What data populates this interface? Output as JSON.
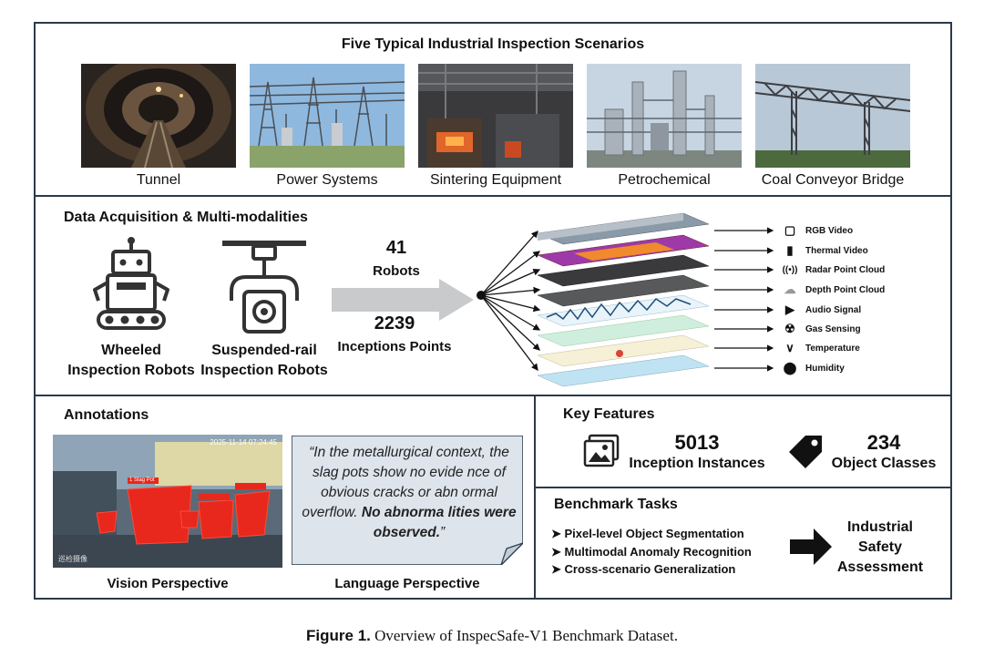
{
  "scenarios": {
    "title": "Five Typical Industrial Inspection Scenarios",
    "items": [
      "Tunnel",
      "Power Systems",
      "Sintering Equipment",
      "Petrochemical",
      "Coal Conveyor Bridge"
    ]
  },
  "acquisition": {
    "title": "Data Acquisition & Multi-modalities",
    "wheeled_label_1": "Wheeled",
    "wheeled_label_2": "Inspection Robots",
    "rail_label_1": "Suspended-rail",
    "rail_label_2": "Inspection Robots",
    "robots_count": "41",
    "robots_label": "Robots",
    "points_count": "2239",
    "points_label": "Inceptions Points",
    "modalities": [
      {
        "icon": "video-camera-icon",
        "label": "RGB Video"
      },
      {
        "icon": "camera-icon",
        "label": "Thermal Video"
      },
      {
        "icon": "radar-icon",
        "label": "Radar Point Cloud"
      },
      {
        "icon": "cloud-icon",
        "label": "Depth Point Cloud"
      },
      {
        "icon": "speaker-icon",
        "label": "Audio Signal"
      },
      {
        "icon": "radiation-icon",
        "label": "Gas Sensing"
      },
      {
        "icon": "thermometer-icon",
        "label": "Temperature"
      },
      {
        "icon": "droplet-icon",
        "label": "Humidity"
      }
    ]
  },
  "annotations": {
    "title": "Annotations",
    "vision_label": "Vision Perspective",
    "language_label": "Language Perspective",
    "quote_plain": "“In the metallurgical context, the slag pots show no evide nce of obvious cracks or abn ormal overflow. ",
    "quote_bold": "No abnorma lities were observed.",
    "quote_end": "”",
    "timestamp": "2025-11-14 07:24:45",
    "box_tag": "1 Slag Pot",
    "watermark": "巡检摄像"
  },
  "key_features": {
    "title": "Key Features",
    "instances_count": "5013",
    "instances_label": "Inception Instances",
    "classes_count": "234",
    "classes_label": "Object Classes"
  },
  "benchmark": {
    "title": "Benchmark Tasks",
    "tasks": [
      "Pixel-level Object Segmentation",
      "Multimodal Anomaly Recognition",
      "Cross-scenario Generalization"
    ],
    "outcome_1": "Industrial",
    "outcome_2": "Safety",
    "outcome_3": "Assessment"
  },
  "caption": {
    "label": "Figure 1.",
    "text": " Overview of InspecSafe-V1 Benchmark Dataset."
  }
}
